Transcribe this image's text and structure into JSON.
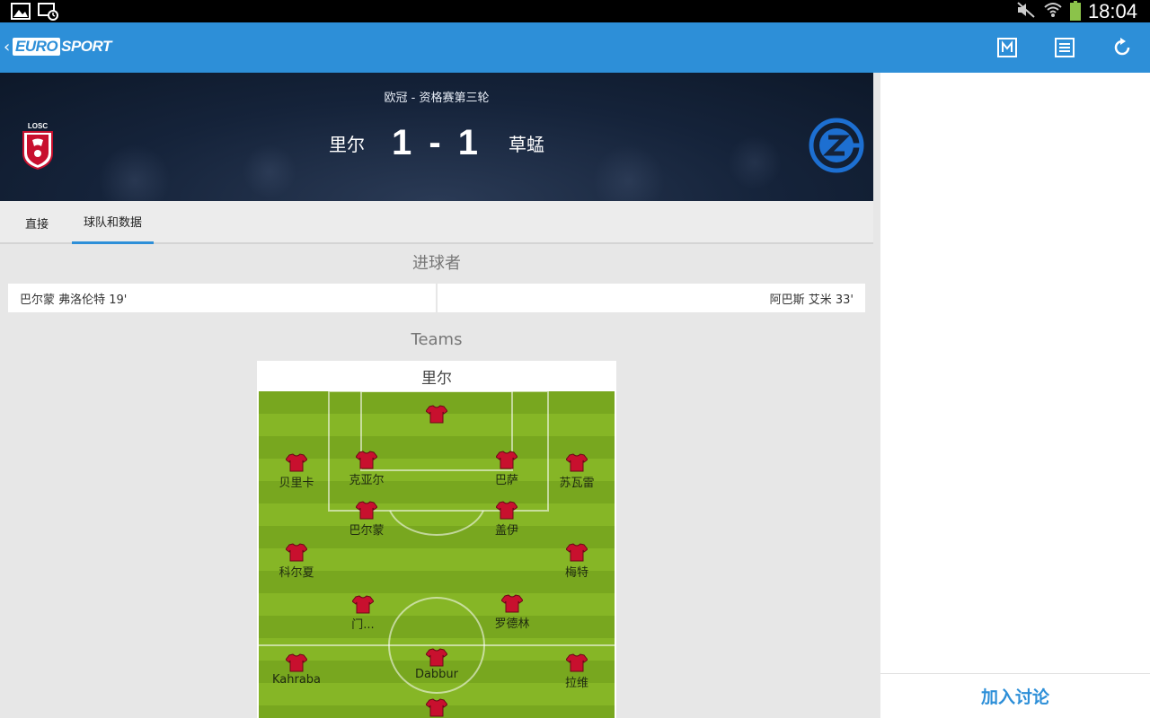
{
  "status_bar": {
    "time": "18:04"
  },
  "app": {
    "back_chevron": "‹",
    "logo_euro": "EURO",
    "logo_sport": "SPORT"
  },
  "header": {
    "competition": "欧冠 - 资格赛第三轮",
    "home_team": "里尔",
    "away_team": "草蜢",
    "score": "1 - 1",
    "home_crest_text": "LOSC"
  },
  "tabs": [
    {
      "label": "直接"
    },
    {
      "label": "球队和数据"
    }
  ],
  "scorers": {
    "title": "进球者",
    "home": "巴尔蒙 弗洛伦特 19'",
    "away": "阿巴斯 艾米 33'"
  },
  "teams": {
    "title": "Teams",
    "lineup_team": "里尔",
    "players": [
      {
        "name": ""
      },
      {
        "name": "贝里卡"
      },
      {
        "name": "克亚尔"
      },
      {
        "name": "巴萨"
      },
      {
        "name": "苏瓦雷"
      },
      {
        "name": "巴尔蒙"
      },
      {
        "name": "盖伊"
      },
      {
        "name": "科尔夏"
      },
      {
        "name": "梅特"
      },
      {
        "name": "门..."
      },
      {
        "name": "罗德林"
      },
      {
        "name": "Kahraba"
      },
      {
        "name": "Dabbur"
      },
      {
        "name": "拉维"
      },
      {
        "name": ""
      }
    ]
  },
  "sidebar": {
    "join_label": "加入讨论"
  },
  "icons": {
    "appbar": [
      "m-icon",
      "list-icon",
      "refresh-icon"
    ],
    "status": [
      "image-icon",
      "screenshot-icon",
      "mute-icon",
      "wifi-icon",
      "battery-icon"
    ]
  },
  "colors": {
    "accent": "#2d8fd8",
    "shirt": "#c8102e",
    "pitch": "#7fae22"
  }
}
